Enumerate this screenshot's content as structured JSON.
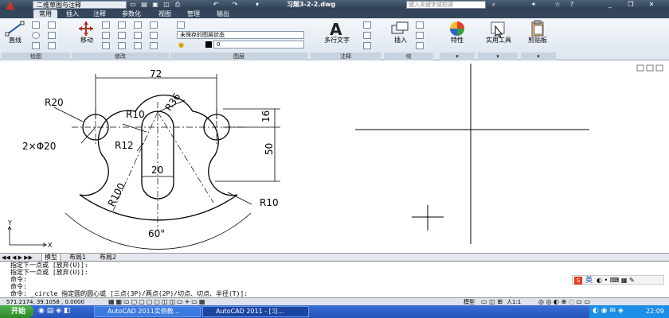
{
  "titlebar": {
    "workspace": "二维草图与注释",
    "document_title": "习题3-2-2.dwg",
    "search_placeholder": "键入关键字或短语"
  },
  "ribbon_tabs": [
    "常用",
    "插入",
    "注释",
    "参数化",
    "视图",
    "管理",
    "输出"
  ],
  "ribbon": {
    "draw": {
      "line_label": "直线",
      "panel": "绘图"
    },
    "modify": {
      "move_label": "移动",
      "panel": "修改"
    },
    "layers": {
      "state": "未保存的图层状态",
      "current_layer": "0",
      "panel": "图层"
    },
    "annotation": {
      "mtext_label": "多行文字",
      "panel": "注释"
    },
    "block": {
      "insert_label": "插入",
      "panel": "块"
    },
    "properties_label": "特性",
    "utilities_label": "实用工具",
    "clipboard_label": "剪贴板"
  },
  "drawing": {
    "dims": {
      "d72": "72",
      "r20": "R20",
      "r10a": "R10",
      "r36": "R36",
      "d16": "16",
      "holes": "2×Φ20",
      "r12": "R12",
      "d50": "50",
      "d20": "20",
      "r100": "R100",
      "r10b": "R10",
      "angle": "60°"
    },
    "ucs_y": "Y",
    "ucs_x": "X"
  },
  "layout_tabs": [
    "模型",
    "布局1",
    "布局2"
  ],
  "command_lines": [
    "指定下一点或 [放弃(U)]:",
    "指定下一点或 [放弃(U)]:",
    "命令:",
    "命令:",
    "命令: _circle 指定圆的圆心或 [三点(3P)/两点(2P)/切点、切点、半径(T)]:"
  ],
  "ime": {
    "label": "英"
  },
  "statusbar": {
    "coords": "571.2174, 39.1058 , 0.0000",
    "model": "模型",
    "scale": "人1:1"
  },
  "taskbar": {
    "start": "开始",
    "tasks": [
      "AutoCAD 2011实例教...",
      "AutoCAD 2011 - [习..."
    ],
    "clock": "22:09"
  }
}
